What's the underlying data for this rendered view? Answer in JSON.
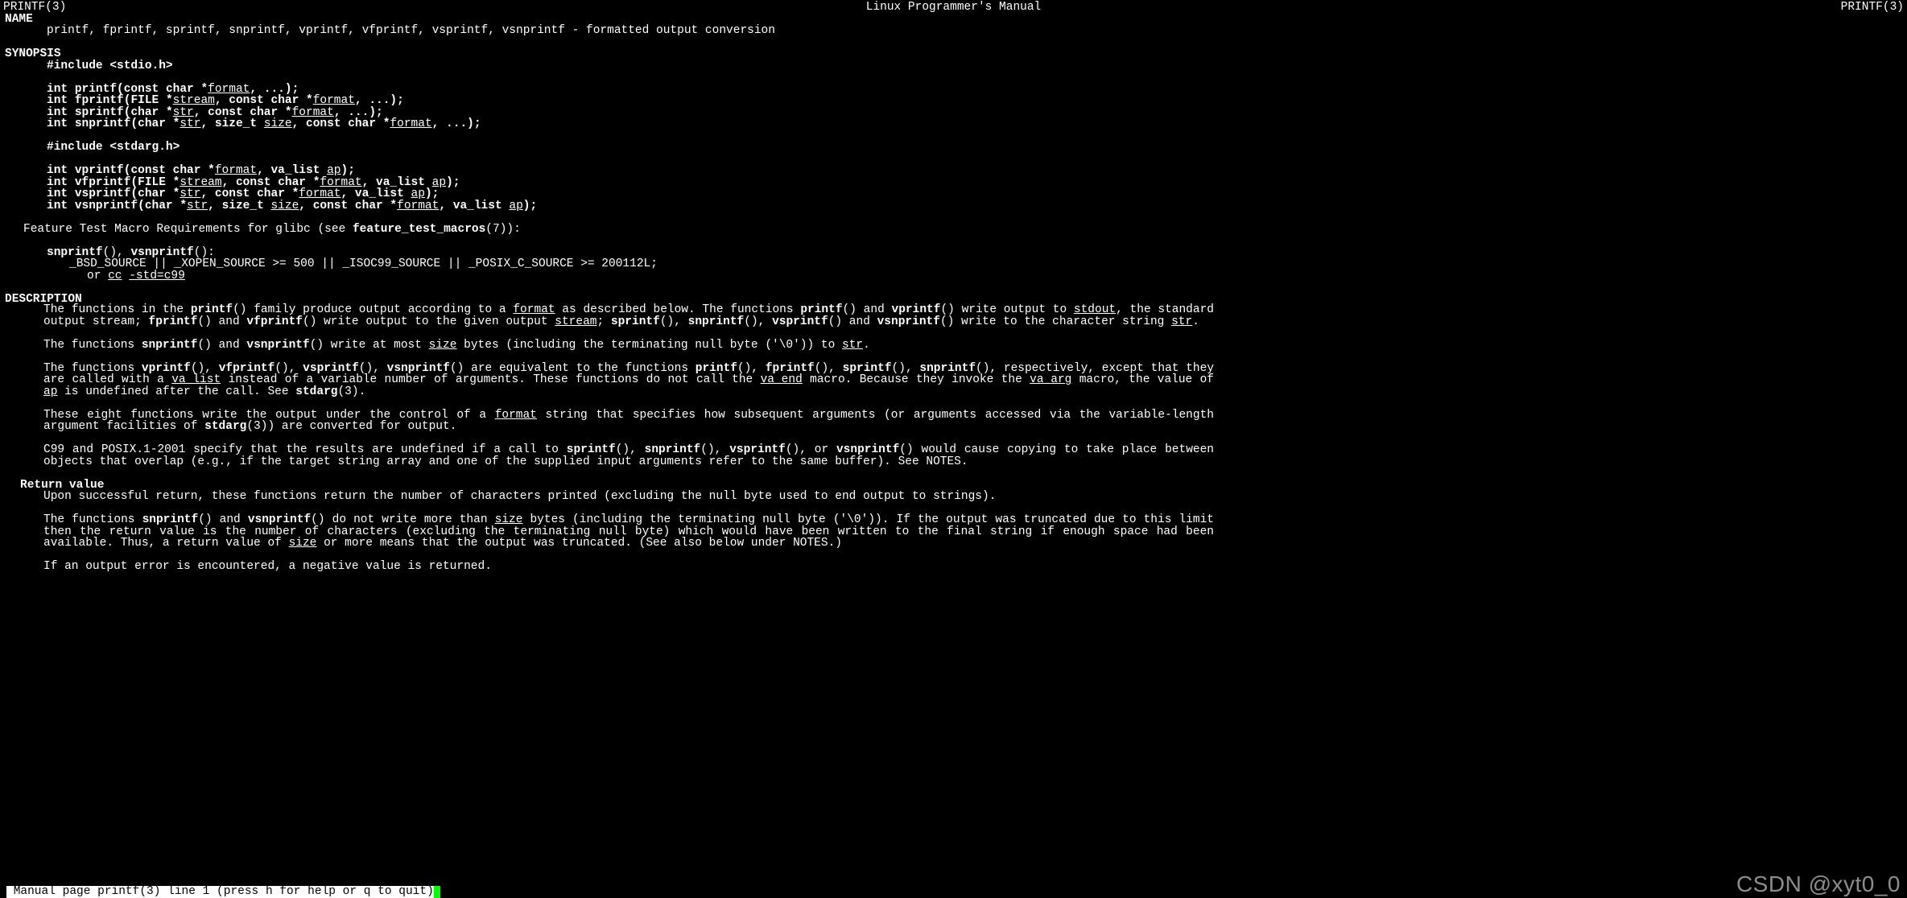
{
  "header": {
    "left": "PRINTF(3)",
    "center": "Linux Programmer's Manual",
    "right": "PRINTF(3)"
  },
  "s": {
    "name": "NAME",
    "name_line": "printf, fprintf, sprintf, snprintf, vprintf, vfprintf, vsprintf, vsnprintf - formatted output conversion",
    "synopsis": "SYNOPSIS",
    "inc1": "#include <stdio.h>",
    "inc2": "#include <stdarg.h>",
    "ftm": "Feature Test Macro Requirements for glibc (see ",
    "ftm_b": "feature_test_macros",
    "ftm_tail": "(7)):",
    "snv": "snprintf",
    "vsnv": "vsnprintf",
    "snv_tail1": "(), ",
    "snv_tail2": "():",
    "macro": "_BSD_SOURCE || _XOPEN_SOURCE >= 500 || _ISOC99_SOURCE || _POSIX_C_SOURCE >= 200112L;",
    "or": "or ",
    "cc": "cc",
    "stdc": "-std=c99",
    "desc": "DESCRIPTION",
    "rv": "Return value",
    "rv1": "Upon successful return, these functions return the number of characters printed (excluding the null byte used to end output to strings).",
    "err": "If an output error is encountered, a negative value is returned."
  },
  "proto": {
    "int": "int ",
    "const_char": "const char *",
    "char": "char *",
    "file": "FILE *",
    "size_t": "size_t ",
    "valist": "va_list ",
    "printf": "printf(",
    "fprintf": "fprintf(",
    "sprintf": "sprintf(",
    "snprintf": "snprintf(",
    "vprintf": "vprintf(",
    "vfprintf": "vfprintf(",
    "vsprintf": "vsprintf(",
    "vsnprintf": "vsnprintf(",
    "format": "format",
    "stream": "stream",
    "str": "str",
    "size": "size",
    "ap": "ap",
    "dots": ", ...);",
    "end": ");",
    "comma": ", "
  },
  "desc": {
    "p1a": "The  functions  in the ",
    "printf": "printf",
    "p1b": "() family produce output according to a ",
    "format": "format",
    "p1c": " as described below.  The functions ",
    "p1d": "() and ",
    "vprintf": "vprintf",
    "p1e": "() write output to ",
    "stdout": "stdout",
    "p1f": ", the standard output stream; ",
    "fprintf": "fprintf",
    "p1g": "() and ",
    "vfprintf": "vfprintf",
    "p1h": "() write output to the given output ",
    "stream": "stream",
    "p1i": "; ",
    "sprintf": "sprintf",
    "p1j": "(), ",
    "snprintf": "snprintf",
    "vsprintf": "vsprintf",
    "p1k": "() and ",
    "vsnprintf": "vsnprintf",
    "p1l": "() write to the character string ",
    "str": "str",
    "p1m": ".",
    "p2a": "The functions ",
    "p2b": "() and ",
    "p2c": "() write at most ",
    "size": "size",
    "p2d": " bytes (including the terminating null byte ('\\0')) to ",
    "p3a": "The functions ",
    "p3b": "(), ",
    "p3c": "() are equivalent to the functions ",
    "p3d": "(), respectively, except that  they  are  called  with  a  ",
    "valist": "va_list",
    "p3e": "instead of a variable number of arguments.  These functions do not call the ",
    "vaend": "va_end",
    "p3f": " macro.  Because they invoke the ",
    "vaarg": "va_arg",
    "p3g": " macro, the value of ",
    "ap": "ap",
    "p3h": " is undefined after the call.  See ",
    "stdarg": "stdarg",
    "p3i": "(3).",
    "p4a": "These  eight  functions  write the output under the control of a ",
    "p4b": " string that specifies how subsequent arguments (or arguments accessed via the variable-length argument facilities of ",
    "p4c": "(3)) are converted for output.",
    "p5a": "C99 and POSIX.1-2001 specify that the results are undefined if a call to ",
    "p5b": "(), or ",
    "p5c": "() would cause copying to take place between objects that overlap (e.g., if the target string array and one of the supplied input arguments refer to the same buffer).  See NOTES.",
    "rv2a": "The  functions  ",
    "rv2b": "()  and ",
    "rv2c": "() do not write more than ",
    "rv2d": " bytes (including the terminating null byte ('\\0')).  If the output was truncated due to this limit then the return value is the number of characters (excluding the terminating null byte) which would have been written to the final string if enough space had been available.  Thus, a return value of ",
    "rv2e": " or more means  that  the output was truncated.  (See also below under NOTES.)"
  },
  "status": " Manual page printf(3) line 1 (press h for help or q to quit)",
  "watermark": "CSDN @xyt0_0"
}
